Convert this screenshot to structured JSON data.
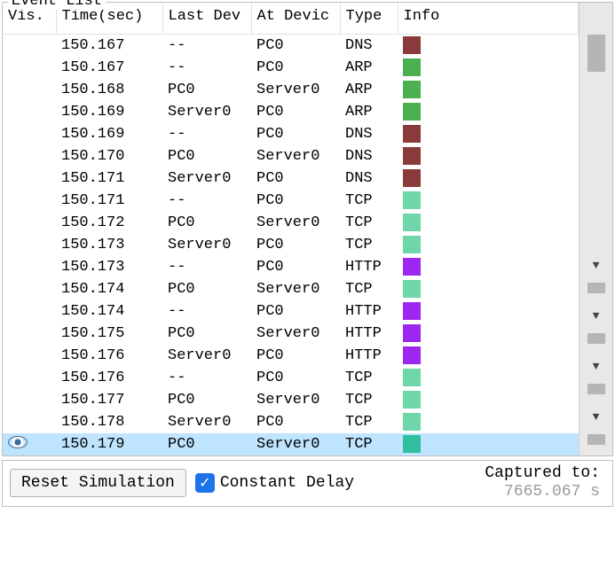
{
  "fieldset_title": "Event List",
  "columns": {
    "vis": "Vis.",
    "time": "Time(sec)",
    "last": "Last Dev",
    "at": "At Devic",
    "type": "Type",
    "info": "Info"
  },
  "colors": {
    "DNS": "#8a3a3a",
    "ARP": "#4caf50",
    "TCP": "#6fd6aa",
    "HTTP": "#9b27f0",
    "TCP_SEL": "#2fbfa0"
  },
  "rows": [
    {
      "vis": "",
      "time": "150.167",
      "last": "--",
      "at": "PC0",
      "type": "DNS",
      "selected": false
    },
    {
      "vis": "",
      "time": "150.167",
      "last": "--",
      "at": "PC0",
      "type": "ARP",
      "selected": false
    },
    {
      "vis": "",
      "time": "150.168",
      "last": "PC0",
      "at": "Server0",
      "type": "ARP",
      "selected": false
    },
    {
      "vis": "",
      "time": "150.169",
      "last": "Server0",
      "at": "PC0",
      "type": "ARP",
      "selected": false
    },
    {
      "vis": "",
      "time": "150.169",
      "last": "--",
      "at": "PC0",
      "type": "DNS",
      "selected": false
    },
    {
      "vis": "",
      "time": "150.170",
      "last": "PC0",
      "at": "Server0",
      "type": "DNS",
      "selected": false
    },
    {
      "vis": "",
      "time": "150.171",
      "last": "Server0",
      "at": "PC0",
      "type": "DNS",
      "selected": false
    },
    {
      "vis": "",
      "time": "150.171",
      "last": "--",
      "at": "PC0",
      "type": "TCP",
      "selected": false
    },
    {
      "vis": "",
      "time": "150.172",
      "last": "PC0",
      "at": "Server0",
      "type": "TCP",
      "selected": false
    },
    {
      "vis": "",
      "time": "150.173",
      "last": "Server0",
      "at": "PC0",
      "type": "TCP",
      "selected": false
    },
    {
      "vis": "",
      "time": "150.173",
      "last": "--",
      "at": "PC0",
      "type": "HTTP",
      "selected": false
    },
    {
      "vis": "",
      "time": "150.174",
      "last": "PC0",
      "at": "Server0",
      "type": "TCP",
      "selected": false
    },
    {
      "vis": "",
      "time": "150.174",
      "last": "--",
      "at": "PC0",
      "type": "HTTP",
      "selected": false
    },
    {
      "vis": "",
      "time": "150.175",
      "last": "PC0",
      "at": "Server0",
      "type": "HTTP",
      "selected": false
    },
    {
      "vis": "",
      "time": "150.176",
      "last": "Server0",
      "at": "PC0",
      "type": "HTTP",
      "selected": false
    },
    {
      "vis": "",
      "time": "150.176",
      "last": "--",
      "at": "PC0",
      "type": "TCP",
      "selected": false
    },
    {
      "vis": "",
      "time": "150.177",
      "last": "PC0",
      "at": "Server0",
      "type": "TCP",
      "selected": false
    },
    {
      "vis": "",
      "time": "150.178",
      "last": "Server0",
      "at": "PC0",
      "type": "TCP",
      "selected": false
    },
    {
      "vis": "eye",
      "time": "150.179",
      "last": "PC0",
      "at": "Server0",
      "type": "TCP",
      "selected": true
    }
  ],
  "bottom": {
    "reset_label": "Reset Simulation",
    "constant_delay_label": "Constant Delay",
    "constant_delay_checked": true,
    "captured_label": "Captured to:",
    "captured_value": "7665.067 s"
  }
}
